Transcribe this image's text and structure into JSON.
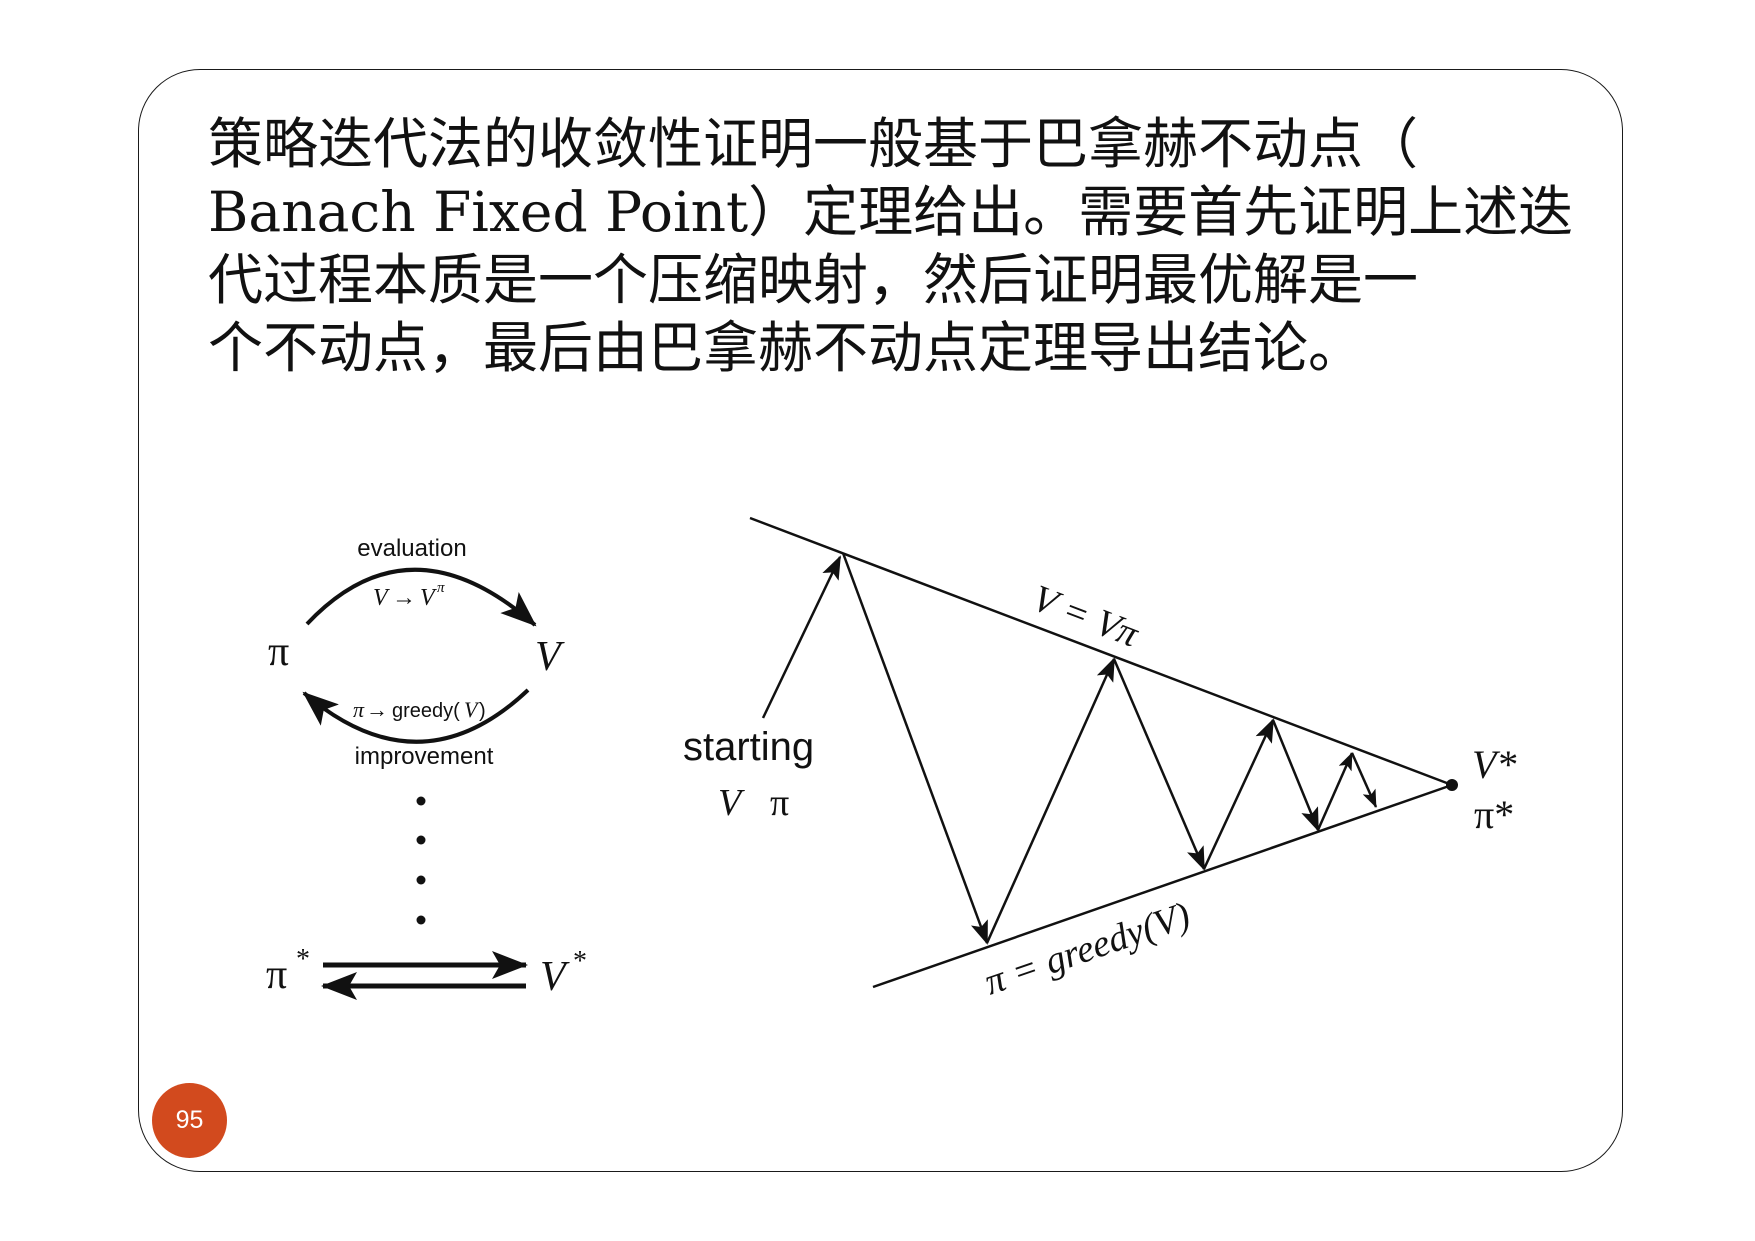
{
  "paragraph": {
    "lines": [
      "策略迭代法的收敛性证明一般基于巴拿赫不动点（",
      "Banach Fixed Point）定理给出。需要首先证明上述迭",
      "代过程本质是一个压缩映射，然后证明最优解是一",
      "个不动点，最后由巴拿赫不动点定理导出结论。"
    ]
  },
  "cycle_diagram": {
    "evaluation_label": "evaluation",
    "evaluation_formula_v": "V",
    "evaluation_formula_arrow": "→",
    "evaluation_formula_vpi": "V",
    "evaluation_formula_sup": "π",
    "pi_label": "π",
    "v_label": "V",
    "improvement_formula_pi": "π",
    "improvement_formula_arrow": "→",
    "improvement_formula_greedy": "greedy(",
    "improvement_formula_v": "V",
    "improvement_formula_close": ")",
    "improvement_label": "improvement",
    "pi_star_base": "π",
    "star": "*",
    "v_star_base": "V"
  },
  "convergence_diagram": {
    "upper_line_label": "V = Vπ",
    "lower_line_label": "π = greedy(V)",
    "start_word": "starting",
    "start_v": "V",
    "start_pi": "π",
    "end_v_star": "V*",
    "end_pi_star": "π*"
  },
  "page_number": "95"
}
